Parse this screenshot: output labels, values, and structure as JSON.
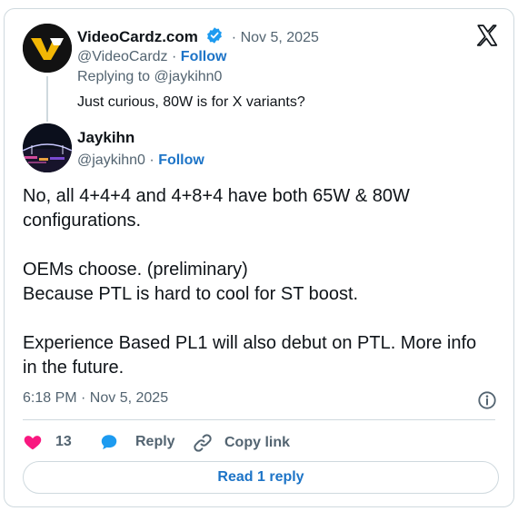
{
  "colors": {
    "accent": "#1d74c7",
    "muted": "#536471",
    "text": "#0f1419",
    "heart": "#f91880",
    "border": "#cfd9de"
  },
  "parent_tweet": {
    "display_name": "VideoCardz.com",
    "separator": "·",
    "date": "Nov 5, 2025",
    "handle": "@VideoCardz",
    "follow_label": "Follow",
    "replying_to": "Replying to @jaykihn0",
    "text": "Just curious, 80W is for X variants?"
  },
  "reply_tweet": {
    "display_name": "Jaykihn",
    "handle": "@jaykihn0",
    "follow_label": "Follow",
    "paragraphs": [
      "No, all 4+4+4 and 4+8+4 have both 65W & 80W configurations.",
      "OEMs choose. (preliminary)",
      "Because PTL is hard to cool for ST boost.",
      "Experience Based PL1 will also debut on PTL. More info in the future."
    ],
    "timestamp": "6:18 PM · Nov 5, 2025"
  },
  "actions": {
    "like_count": "13",
    "reply_label": "Reply",
    "copy_link_label": "Copy link"
  },
  "read_replies_label": "Read 1 reply",
  "icons": [
    "videocardz-logo",
    "verified-badge-icon",
    "x-logo-icon",
    "info-icon",
    "heart-icon",
    "reply-bubble-icon",
    "link-icon"
  ]
}
